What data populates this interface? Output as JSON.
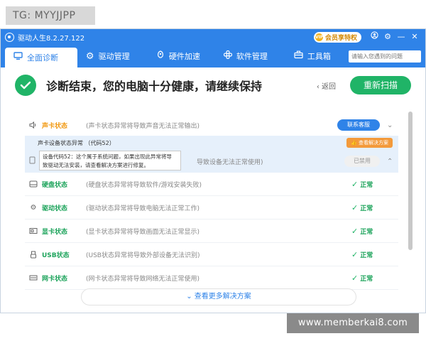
{
  "watermarks": {
    "tg": "TG: MYYJJPP",
    "site": "www.memberkai8.com"
  },
  "titlebar": {
    "app_name": "驱动人生8.2.27.122",
    "vip_icon_text": "VIP",
    "vip_label": "会员享特权",
    "icons": [
      "user-icon",
      "gear-icon",
      "minimize-icon",
      "close-icon"
    ]
  },
  "nav": {
    "tabs": [
      {
        "label": "全面诊断",
        "icon": "monitor-icon",
        "active": true
      },
      {
        "label": "驱动管理",
        "icon": "gear-icon",
        "active": false
      },
      {
        "label": "硬件加速",
        "icon": "rocket-icon",
        "active": false
      },
      {
        "label": "软件管理",
        "icon": "apps-icon",
        "active": false
      },
      {
        "label": "工具箱",
        "icon": "toolbox-icon",
        "active": false
      }
    ],
    "search_placeholder": "请输入您遇到的问题"
  },
  "summary": {
    "message": "诊断结束，您的电脑十分健康，请继续保持",
    "back_label": "返回",
    "rescan_label": "重新扫描"
  },
  "sound_row": {
    "name": "声卡状态",
    "desc": "(声卡状态异常将导致声音无法正常输出)",
    "contact_label": "联系客服"
  },
  "error_panel": {
    "title": "声卡设备状态异常 （代码52）",
    "solve_label": "查看解决方案",
    "tooltip_line1": "设备代码52：这个属于系统问题，如果出现此异常将导",
    "tooltip_line2": "致驱动无法安装，请查看解决方案进行修复。",
    "desc_tail": "导致设备无法正常使用)",
    "disabled_label": "已禁用"
  },
  "rows": [
    {
      "name": "硬盘状态",
      "desc": "(硬盘状态异常将导致软件/游戏安装失败)",
      "status": "正常",
      "icon": "harddisk-icon"
    },
    {
      "name": "驱动状态",
      "desc": "(驱动状态异常将导致电脑无法正常工作)",
      "status": "正常",
      "icon": "gear-icon"
    },
    {
      "name": "显卡状态",
      "desc": "(显卡状态异常将导致画面无法正常显示)",
      "status": "正常",
      "icon": "gpu-icon"
    },
    {
      "name": "USB状态",
      "desc": "(USB状态异常将导致外部设备无法识别)",
      "status": "正常",
      "icon": "usb-icon"
    },
    {
      "name": "网卡状态",
      "desc": "(网卡状态异常将导致网络无法正常使用)",
      "status": "正常",
      "icon": "network-icon"
    }
  ],
  "footer": {
    "more_label": "查看更多解决方案"
  },
  "colors": {
    "brand_blue": "#2f83e8",
    "success_green": "#20b467",
    "warning_orange": "#f19a15"
  }
}
